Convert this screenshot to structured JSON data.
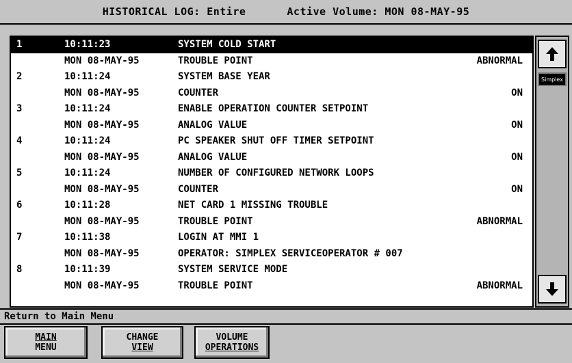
{
  "header": {
    "title": "HISTORICAL LOG: Entire",
    "volume": "Active Volume: MON 08-MAY-95"
  },
  "log": {
    "entries": [
      {
        "num": "1",
        "time": "10:11:23",
        "desc": "SYSTEM COLD START",
        "date": "MON 08-MAY-95",
        "type": "TROUBLE POINT",
        "status": "ABNORMAL",
        "selected": true
      },
      {
        "num": "2",
        "time": "10:11:24",
        "desc": "SYSTEM BASE YEAR",
        "date": "MON 08-MAY-95",
        "type": "COUNTER",
        "status": "ON"
      },
      {
        "num": "3",
        "time": "10:11:24",
        "desc": "ENABLE OPERATION COUNTER SETPOINT",
        "date": "MON 08-MAY-95",
        "type": "ANALOG VALUE",
        "status": "ON"
      },
      {
        "num": "4",
        "time": "10:11:24",
        "desc": "PC SPEAKER SHUT OFF TIMER SETPOINT",
        "date": "MON 08-MAY-95",
        "type": "ANALOG VALUE",
        "status": "ON"
      },
      {
        "num": "5",
        "time": "10:11:24",
        "desc": "NUMBER OF CONFIGURED NETWORK LOOPS",
        "date": "MON 08-MAY-95",
        "type": "COUNTER",
        "status": "ON"
      },
      {
        "num": "6",
        "time": "10:11:28",
        "desc": "NET CARD 1 MISSING TROUBLE",
        "date": "MON 08-MAY-95",
        "type": "TROUBLE POINT",
        "status": "ABNORMAL"
      },
      {
        "num": "7",
        "time": "10:11:38",
        "desc": "LOGIN AT MMI 1",
        "date": "MON 08-MAY-95",
        "type": "OPERATOR: SIMPLEX SERVICEOPERATOR # 007",
        "status": ""
      },
      {
        "num": "8",
        "time": "10:11:39",
        "desc": "SYSTEM SERVICE MODE",
        "date": "MON 08-MAY-95",
        "type": "TROUBLE POINT",
        "status": "ABNORMAL"
      }
    ]
  },
  "scrollbar": {
    "up_icon": "arrow-up-icon",
    "down_icon": "arrow-down-icon",
    "logo": "Simplex"
  },
  "status_line": "Return to Main Menu",
  "buttons": {
    "main": {
      "line1": "MAIN",
      "line2": "MENU"
    },
    "change": {
      "line1": "CHANGE",
      "line2": "VIEW"
    },
    "volume": {
      "line1": "VOLUME",
      "line2": "OPERATIONS"
    }
  }
}
